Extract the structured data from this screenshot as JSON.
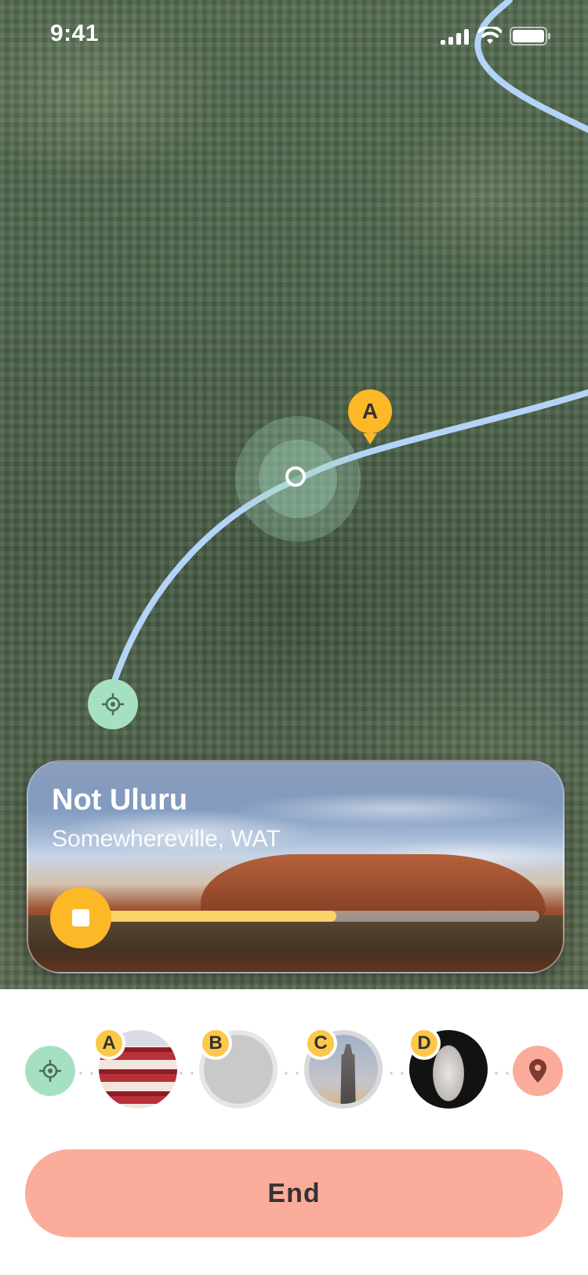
{
  "status_bar": {
    "time": "9:41"
  },
  "map": {
    "waypoint_label": "A",
    "colors": {
      "route": "#b3d3f7",
      "waypoint": "#fdb827",
      "start": "#a6e0c2"
    }
  },
  "card": {
    "title": "Not Uluru",
    "subtitle": "Somewhereville, WAT",
    "progress_fraction": 0.54
  },
  "stops": [
    {
      "label": "A",
      "image": "pagoda"
    },
    {
      "label": "B",
      "image": "placeholder"
    },
    {
      "label": "C",
      "image": "skyscraper"
    },
    {
      "label": "D",
      "image": "statue"
    }
  ],
  "end_button": {
    "label": "End",
    "color": "#fbac9a"
  }
}
